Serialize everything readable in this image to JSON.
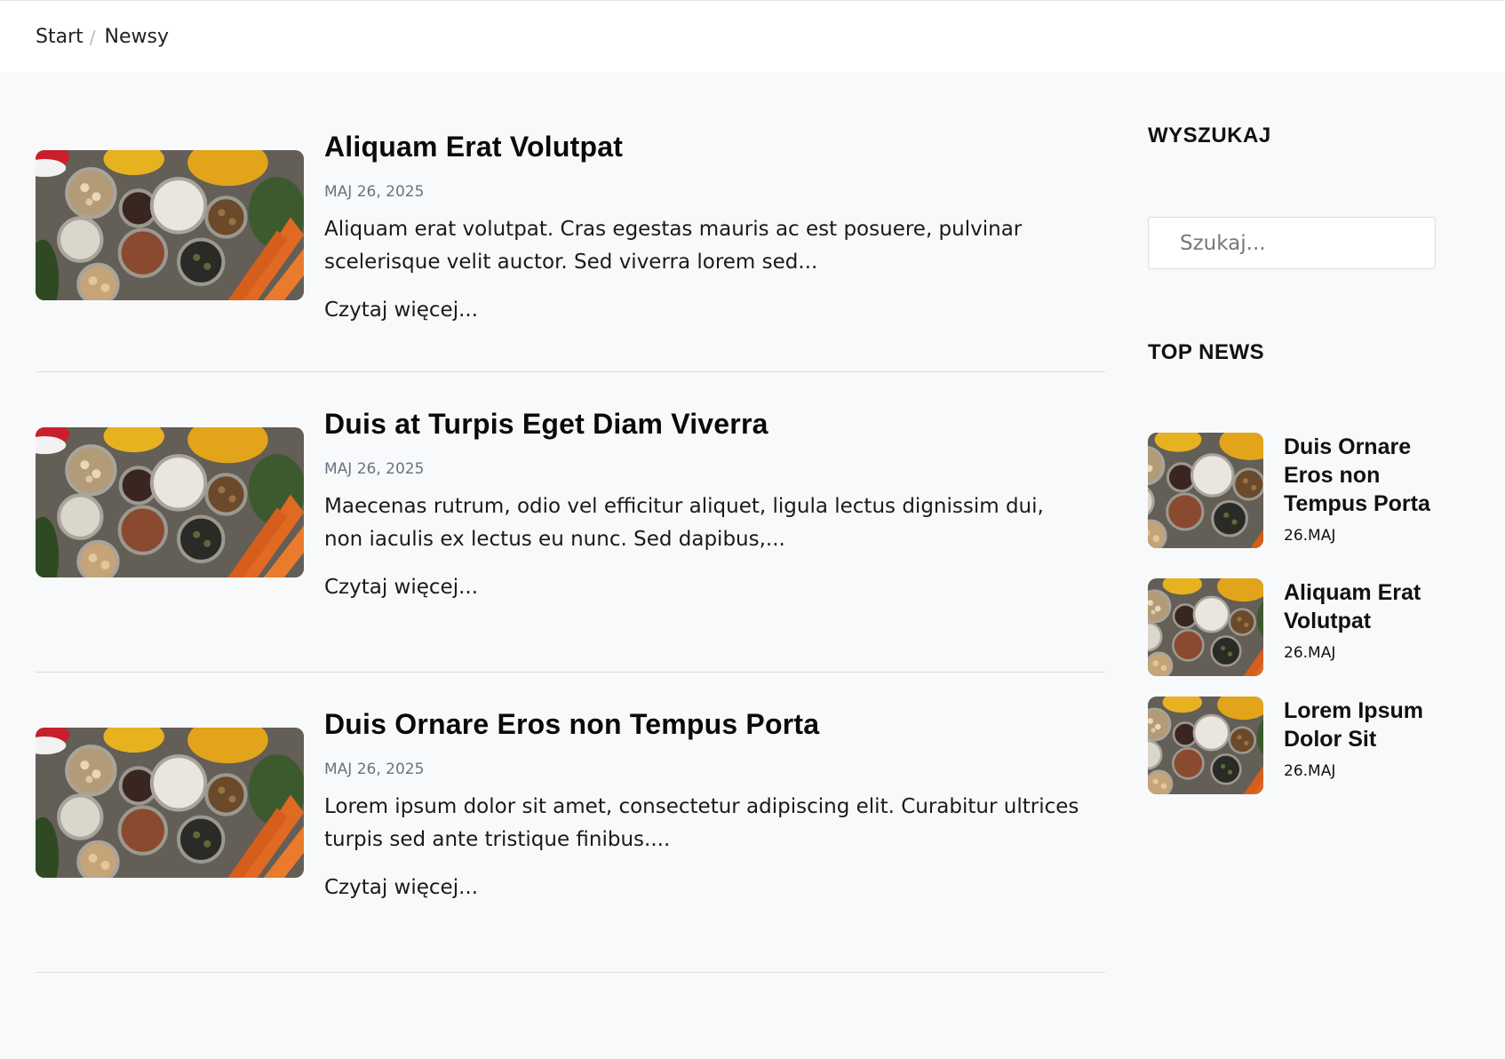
{
  "breadcrumb": {
    "home": "Start",
    "separator": "/",
    "current": "Newsy"
  },
  "articles": [
    {
      "title": "Aliquam Erat Volutpat",
      "date": "MAJ 26, 2025",
      "excerpt": "Aliquam erat volutpat. Cras egestas mauris ac est posuere, pulvinar scelerisque velit auctor. Sed viverra lorem sed...",
      "more": "Czytaj więcej..."
    },
    {
      "title": "Duis at Turpis Eget Diam Viverra",
      "date": "MAJ 26, 2025",
      "excerpt": "Maecenas rutrum, odio vel efficitur aliquet, ligula lectus dignissim dui, non iaculis ex lectus eu nunc. Sed dapibus,...",
      "more": "Czytaj więcej..."
    },
    {
      "title": "Duis Ornare Eros non Tempus Porta",
      "date": "MAJ 26, 2025",
      "excerpt": "Lorem ipsum dolor sit amet, consectetur adipiscing elit. Curabitur ultrices turpis sed ante tristique finibus....",
      "more": "Czytaj więcej..."
    }
  ],
  "sidebar": {
    "search_heading": "WYSZUKAJ",
    "search_placeholder": "Szukaj...",
    "top_heading": "TOP NEWS",
    "top_news": [
      {
        "title": "Duis Ornare Eros non Tempus Porta",
        "date": "26.MAJ"
      },
      {
        "title": "Aliquam Erat Volutpat",
        "date": "26.MAJ"
      },
      {
        "title": "Lorem Ipsum Dolor Sit",
        "date": "26.MAJ"
      }
    ]
  }
}
